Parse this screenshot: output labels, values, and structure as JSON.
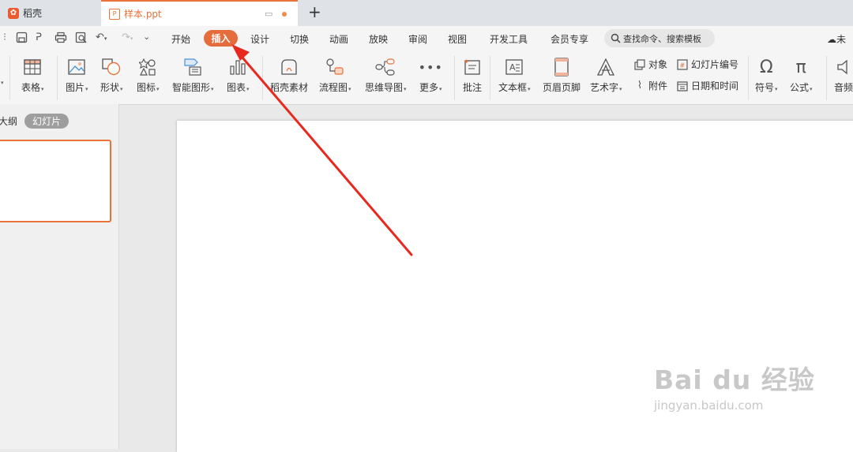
{
  "tabs": {
    "home": {
      "label": "稻壳"
    },
    "doc": {
      "label": "样本.ppt"
    },
    "new_tab": "+"
  },
  "menu": {
    "items": [
      "开始",
      "插入",
      "设计",
      "切换",
      "动画",
      "放映",
      "审阅",
      "视图",
      "开发工具",
      "会员专享"
    ],
    "active": "插入",
    "search_placeholder": "查找命令、搜索模板",
    "cloud_label": "未"
  },
  "ribbon": {
    "table": "表格",
    "picture": "图片",
    "shape": "形状",
    "icon": "图标",
    "smart_art": "智能图形",
    "chart": "图表",
    "daoke": "稻壳素材",
    "flowchart": "流程图",
    "mindmap": "思维导图",
    "more": "更多",
    "comment": "批注",
    "textbox": "文本框",
    "header_footer": "页眉页脚",
    "wordart": "艺术字",
    "object": "对象",
    "attachment": "附件",
    "slide_number": "幻灯片编号",
    "datetime": "日期和时间",
    "symbol": "符号",
    "formula": "公式",
    "audio": "音频"
  },
  "panel": {
    "outline": "大纲",
    "slides": "幻灯片"
  },
  "watermark": {
    "main": "Bai du 经验",
    "sub": "jingyan.baidu.com"
  },
  "colors": {
    "accent": "#e7723a",
    "arrow": "#e8281e"
  }
}
